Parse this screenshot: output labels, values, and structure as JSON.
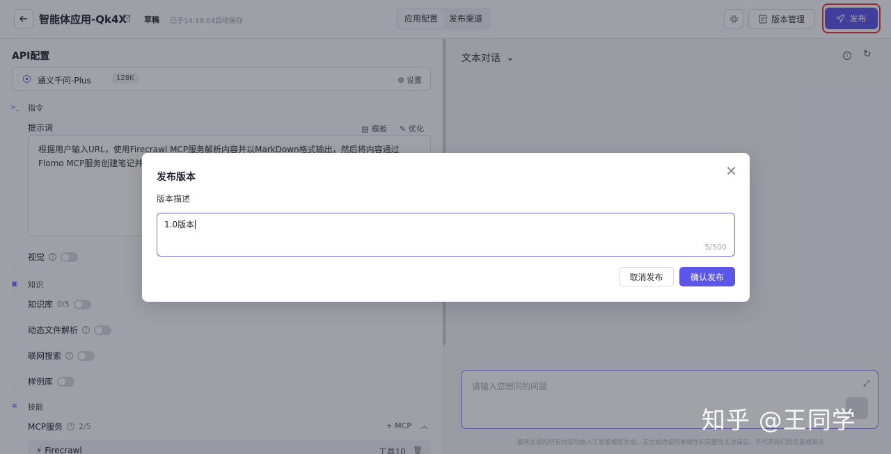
{
  "header": {
    "app_title": "智能体应用-Qk4X",
    "status_tag": "草稿",
    "save_status": "已于14:19:04自动保存",
    "tabs": [
      {
        "label": "应用配置",
        "active": true
      },
      {
        "label": "发布渠道",
        "active": false
      }
    ],
    "version_button": "版本管理",
    "publish_button": "发布",
    "accent_color": "#5b55e8",
    "highlight_color": "#e53935"
  },
  "left_panel": {
    "section_title": "API配置",
    "model": {
      "name": "通义千问-Plus",
      "context_badge": "128K",
      "settings_label": "设置"
    },
    "instruction_group": "指令",
    "prompt": {
      "label": "提示词",
      "template_label": "模板",
      "optimize_label": "优化",
      "text_line1": "根据用户输入URL，使用Firecrawl MCP服务解析内容并以MarkDown格式输出，然后将内容通过",
      "text_line2": "Flomo MCP服务创建笔记并"
    },
    "vision_label": "视觉",
    "knowledge_group": "知识",
    "knowledge_base": {
      "label": "知识库",
      "count": "0/5"
    },
    "dynamic_file": {
      "label": "动态文件解析"
    },
    "web_search": {
      "label": "联网搜索"
    },
    "sample_library": {
      "label": "样例库"
    },
    "skills_group": "技能",
    "mcp": {
      "label": "MCP服务",
      "count": "2/5",
      "add_label": "+ MCP",
      "item_name": "Firecrawl",
      "item_tools": "工具10"
    }
  },
  "right_panel": {
    "chat_mode": "文本对话",
    "input_placeholder": "请输入您想问的问题",
    "footer_note": "服务生成的所有内容均由人工智能模型生成，其生成内容的准确性和完整性无法保证，不代表我们的态度或观点"
  },
  "modal": {
    "title": "发布版本",
    "field_label": "版本描述",
    "field_value": "1.0版本",
    "counter": "5/500",
    "cancel_button": "取消发布",
    "confirm_button": "确认发布"
  },
  "watermark": "知乎 @王同学"
}
